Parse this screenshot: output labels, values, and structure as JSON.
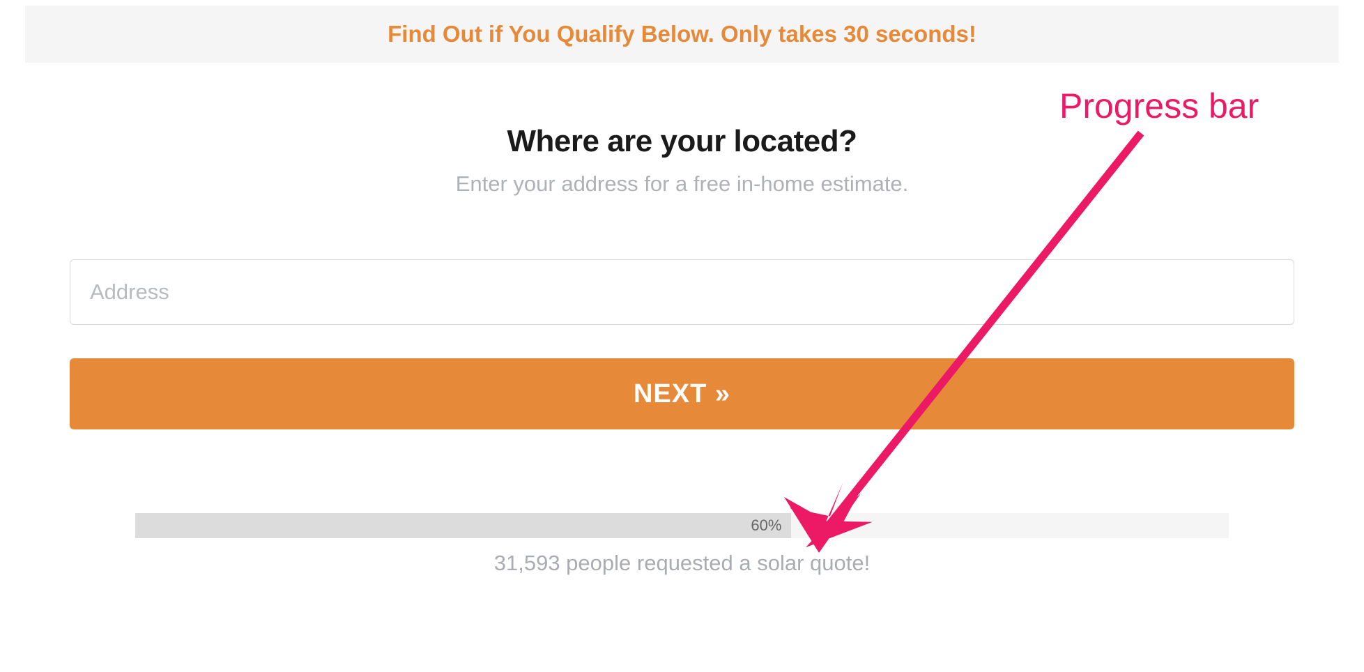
{
  "banner": {
    "text": "Find Out if You Qualify Below. Only takes 30 seconds!"
  },
  "form": {
    "heading": "Where are your located?",
    "subheading": "Enter your address for a free in-home estimate.",
    "address_placeholder": "Address",
    "address_value": "",
    "next_label": "NEXT »"
  },
  "progress": {
    "percent_label": "60%",
    "percent_value": 60,
    "stats_text": "31,593 people requested a solar quote!"
  },
  "annotation": {
    "label": "Progress bar"
  },
  "colors": {
    "accent": "#e68a3a",
    "annotation": "#ec1965"
  }
}
